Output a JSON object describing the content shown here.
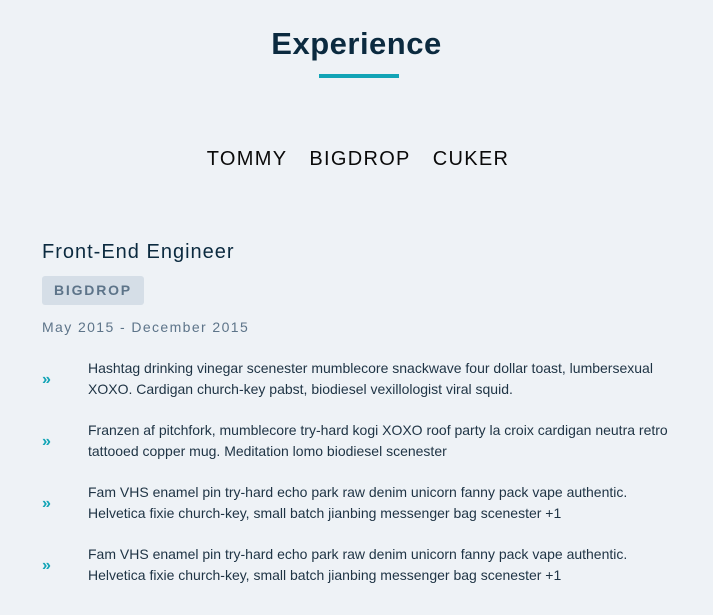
{
  "section": {
    "title": "Experience"
  },
  "tabs": [
    {
      "label": "TOMMY"
    },
    {
      "label": "BIGDROP"
    },
    {
      "label": "CUKER"
    }
  ],
  "job": {
    "title": "Front-End Engineer",
    "company": "BIGDROP",
    "dates": "May 2015 - December 2015",
    "duties": [
      {
        "icon": "double-chevron-right-icon",
        "text": "Hashtag drinking vinegar scenester mumblecore snackwave four dollar toast, lumbersexual XOXO. Cardigan church-key pabst, biodiesel vexillologist viral squid."
      },
      {
        "icon": "double-chevron-right-icon",
        "text": "Franzen af pitchfork, mumblecore try-hard kogi XOXO roof party la croix cardigan neutra retro tattooed copper mug. Meditation lomo biodiesel scenester"
      },
      {
        "icon": "double-chevron-right-icon",
        "text": "Fam VHS enamel pin try-hard echo park raw denim unicorn fanny pack vape authentic. Helvetica fixie church-key, small batch jianbing messenger bag scenester +1"
      },
      {
        "icon": "double-chevron-right-icon",
        "text": "Fam VHS enamel pin try-hard echo park raw denim unicorn fanny pack vape authentic. Helvetica fixie church-key, small batch jianbing messenger bag scenester +1"
      }
    ]
  },
  "colors": {
    "background": "#eef2f6",
    "accent": "#12a4b6",
    "heading": "#0b2a3f",
    "badge_bg": "#d5dee7",
    "muted": "#5d7489"
  }
}
